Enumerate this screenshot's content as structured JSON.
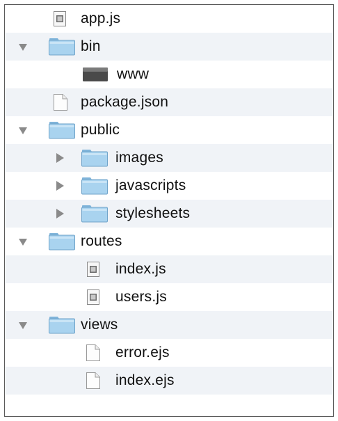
{
  "tree": {
    "items": [
      {
        "label": "app.js",
        "icon": "js-file-icon",
        "depth": 0,
        "expander": "none"
      },
      {
        "label": "bin",
        "icon": "folder-icon",
        "depth": 0,
        "expander": "expanded"
      },
      {
        "label": "www",
        "icon": "executable-file-icon",
        "depth": 1,
        "expander": "none"
      },
      {
        "label": "package.json",
        "icon": "blank-file-icon",
        "depth": 0,
        "expander": "none"
      },
      {
        "label": "public",
        "icon": "folder-icon",
        "depth": 0,
        "expander": "expanded"
      },
      {
        "label": "images",
        "icon": "folder-icon",
        "depth": 1,
        "expander": "collapsed"
      },
      {
        "label": "javascripts",
        "icon": "folder-icon",
        "depth": 1,
        "expander": "collapsed"
      },
      {
        "label": "stylesheets",
        "icon": "folder-icon",
        "depth": 1,
        "expander": "collapsed"
      },
      {
        "label": "routes",
        "icon": "folder-icon",
        "depth": 0,
        "expander": "expanded"
      },
      {
        "label": "index.js",
        "icon": "js-file-icon",
        "depth": 1,
        "expander": "none"
      },
      {
        "label": "users.js",
        "icon": "js-file-icon",
        "depth": 1,
        "expander": "none"
      },
      {
        "label": "views",
        "icon": "folder-icon",
        "depth": 0,
        "expander": "expanded"
      },
      {
        "label": "error.ejs",
        "icon": "blank-file-icon",
        "depth": 1,
        "expander": "none"
      },
      {
        "label": "index.ejs",
        "icon": "blank-file-icon",
        "depth": 1,
        "expander": "none"
      }
    ]
  },
  "colors": {
    "folder": "#8fc3e6",
    "folder_dark": "#5f9cc7",
    "triangle": "#8a8a8a",
    "stripe": "#f0f3f7"
  }
}
